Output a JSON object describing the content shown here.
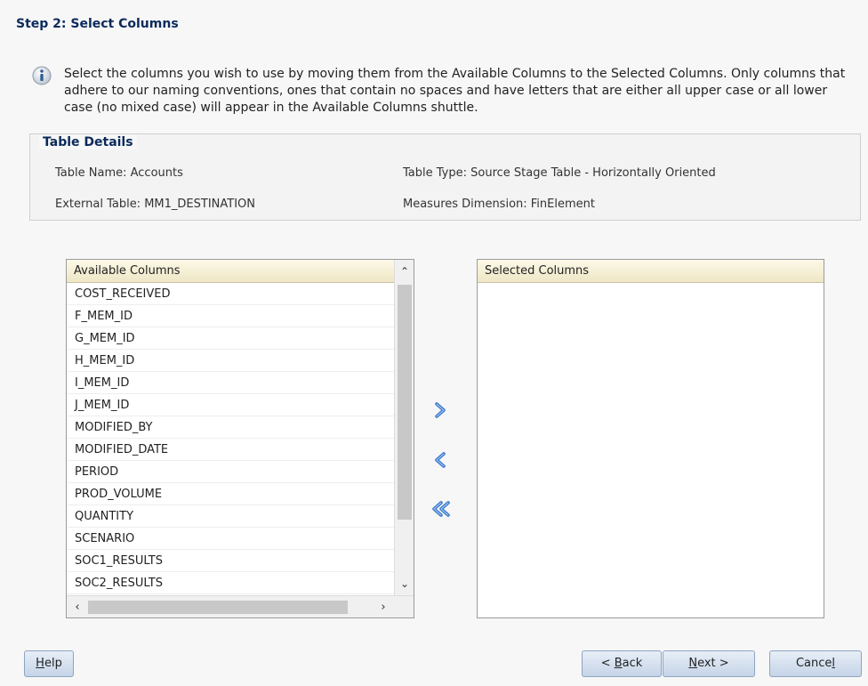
{
  "step_title": "Step 2: Select Columns",
  "info": {
    "icon": "info-icon",
    "text": "Select the columns you wish to use by moving them from the Available Columns to the Selected Columns. Only columns that adhere to our naming conventions, ones that contain no spaces and have letters that are either all upper case or all lower case (no mixed case) will appear in the Available Columns shuttle."
  },
  "table_details": {
    "legend": "Table Details",
    "table_name": "Table Name: Accounts",
    "table_type": "Table Type: Source Stage Table - Horizontally Oriented",
    "external_table": "External Table: MM1_DESTINATION",
    "measures_dimension": "Measures Dimension: FinElement"
  },
  "available": {
    "header": "Available Columns",
    "items": [
      "COST_RECEIVED",
      "F_MEM_ID",
      "G_MEM_ID",
      "H_MEM_ID",
      "I_MEM_ID",
      "J_MEM_ID",
      "MODIFIED_BY",
      "MODIFIED_DATE",
      "PERIOD",
      "PROD_VOLUME",
      "QUANTITY",
      "SCENARIO",
      "SOC1_RESULTS",
      "SOC2_RESULTS"
    ]
  },
  "selected": {
    "header": "Selected Columns"
  },
  "shuttle": {
    "move_right_icon": "chevron-right-icon",
    "move_left_icon": "chevron-left-icon",
    "move_all_left_icon": "double-chevron-left-icon"
  },
  "buttons": {
    "help_key": "H",
    "help_rest": "elp",
    "back_prefix": "< ",
    "back_key": "B",
    "back_rest": "ack",
    "next_key": "N",
    "next_rest": "ext >",
    "cancel_pre": "Cance",
    "cancel_key": "l"
  },
  "colors": {
    "title": "#0b2a5b",
    "list_header_bg": "#f2ecd0",
    "shuttle_arrow": "#2d6fc7"
  }
}
